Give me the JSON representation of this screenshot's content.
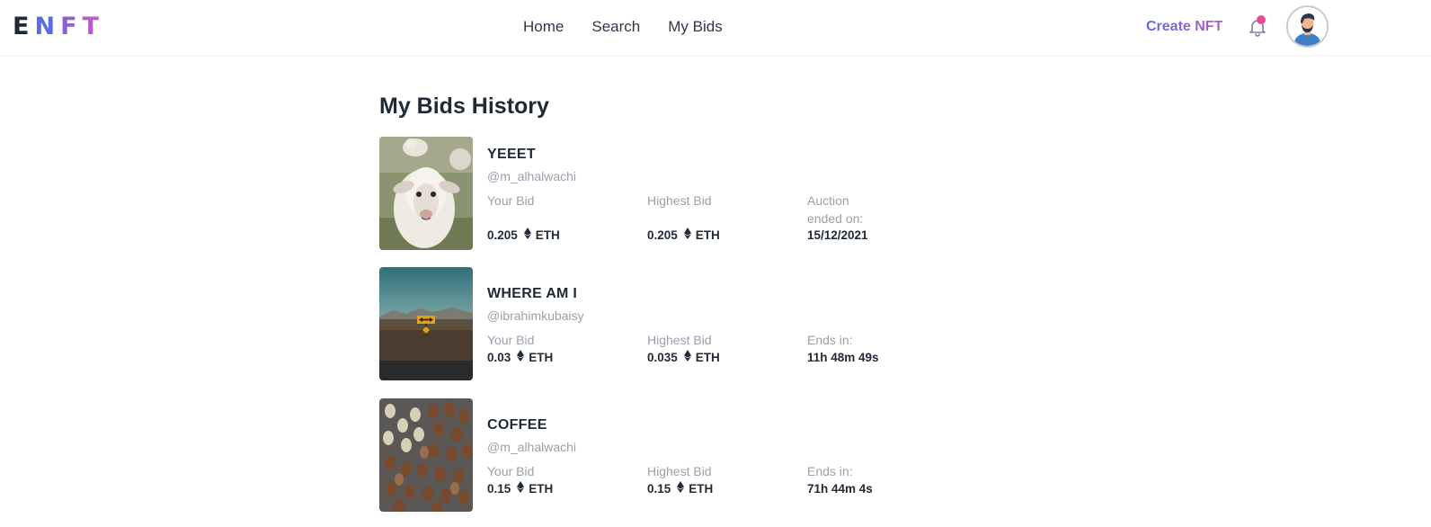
{
  "header": {
    "logo_letters": [
      "E",
      "N",
      "F",
      "T"
    ],
    "nav": [
      "Home",
      "Search",
      "My Bids"
    ],
    "create_label": "Create NFT"
  },
  "colors": {
    "logo": [
      "#1f2937",
      "#5b6be0",
      "#8a63d2",
      "#b45bc9"
    ],
    "accent_gradient": [
      "#5b6be0",
      "#b45bc9"
    ],
    "notification_dot": "#ec4899",
    "text_dark": "#1f2937",
    "text_muted": "#9aa0ab"
  },
  "icons": {
    "bell": "bell-icon",
    "eth": "ethereum-icon",
    "avatar": "user-avatar"
  },
  "page": {
    "title": "My Bids History"
  },
  "labels": {
    "your_bid": "Your Bid",
    "highest_bid": "Highest Bid",
    "currency": "ETH"
  },
  "bids": [
    {
      "name": "YEEET",
      "owner": "@m_alhalwachi",
      "image": "sheep",
      "your_bid": "0.205",
      "highest_bid": "0.205",
      "status_label": "Auction ended on:",
      "status_value": "15/12/2021"
    },
    {
      "name": "WHERE AM I",
      "owner": "@ibrahimkubaisy",
      "image": "desert-road-sign",
      "your_bid": "0.03",
      "highest_bid": "0.035",
      "status_label": "Ends in:",
      "status_value": "11h 48m 49s"
    },
    {
      "name": "COFFEE",
      "owner": "@m_alhalwachi",
      "image": "coffee-beans",
      "your_bid": "0.15",
      "highest_bid": "0.15",
      "status_label": "Ends in:",
      "status_value": "71h 44m 4s"
    }
  ]
}
